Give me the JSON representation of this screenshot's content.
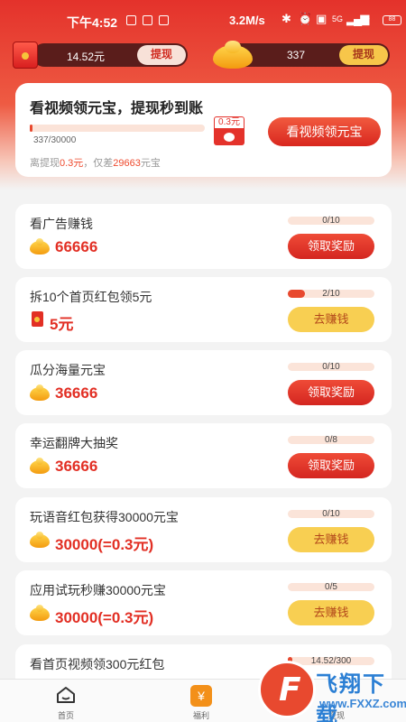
{
  "status_bar": {
    "time": "下午4:52",
    "speed": "3.2M/s",
    "signal": "5G",
    "battery": "88"
  },
  "balance": {
    "cash_value": "14.52元",
    "cash_withdraw_label": "提现",
    "ingot_value": "337",
    "ingot_withdraw_label": "提现"
  },
  "hero": {
    "title": "看视频领元宝，提现秒到账",
    "progress_text": "337/30000",
    "progress_fraction": 0.011,
    "badge_amount": "0.3元",
    "note_prefix": "离提现",
    "note_amount": "0.3元",
    "note_middle": "，仅差",
    "note_remaining": "29663",
    "note_suffix": "元宝",
    "button_label": "看视频领元宝"
  },
  "tasks": [
    {
      "title": "看广告赚钱",
      "reward": "66666",
      "reward_icon": "ingot-icon",
      "progress_text": "0/10",
      "progress_fraction": 0,
      "button_label": "领取奖励",
      "button_style": "red"
    },
    {
      "title": "拆10个首页红包领5元",
      "reward": "5元",
      "reward_icon": "red-envelope-icon",
      "progress_text": "2/10",
      "progress_fraction": 0.2,
      "button_label": "去赚钱",
      "button_style": "yellow"
    },
    {
      "title": "瓜分海量元宝",
      "reward": "36666",
      "reward_icon": "ingot-icon",
      "progress_text": "0/10",
      "progress_fraction": 0,
      "button_label": "领取奖励",
      "button_style": "red"
    },
    {
      "title": "幸运翻牌大抽奖",
      "reward": "36666",
      "reward_icon": "ingot-icon",
      "progress_text": "0/8",
      "progress_fraction": 0,
      "button_label": "领取奖励",
      "button_style": "red"
    },
    {
      "title": "玩语音红包获得30000元宝",
      "reward": "30000(=0.3元)",
      "reward_icon": "ingot-icon",
      "progress_text": "0/10",
      "progress_fraction": 0,
      "button_label": "去赚钱",
      "button_style": "yellow"
    },
    {
      "title": "应用试玩秒赚30000元宝",
      "reward": "30000(=0.3元)",
      "reward_icon": "ingot-icon",
      "progress_text": "0/5",
      "progress_fraction": 0,
      "button_label": "去赚钱",
      "button_style": "yellow"
    },
    {
      "title": "看首页视频领300元红包",
      "reward": "",
      "reward_icon": "",
      "progress_text": "14.52/300",
      "progress_fraction": 0.048,
      "button_label": "",
      "button_style": ""
    }
  ],
  "bottom_nav": {
    "home_label": "首页",
    "welfare_icon_glyph": "¥",
    "welfare_label": "福利",
    "withdraw_label": "提现"
  },
  "watermark": {
    "title": "飞翔下载",
    "url": "www.FXXZ.com"
  }
}
